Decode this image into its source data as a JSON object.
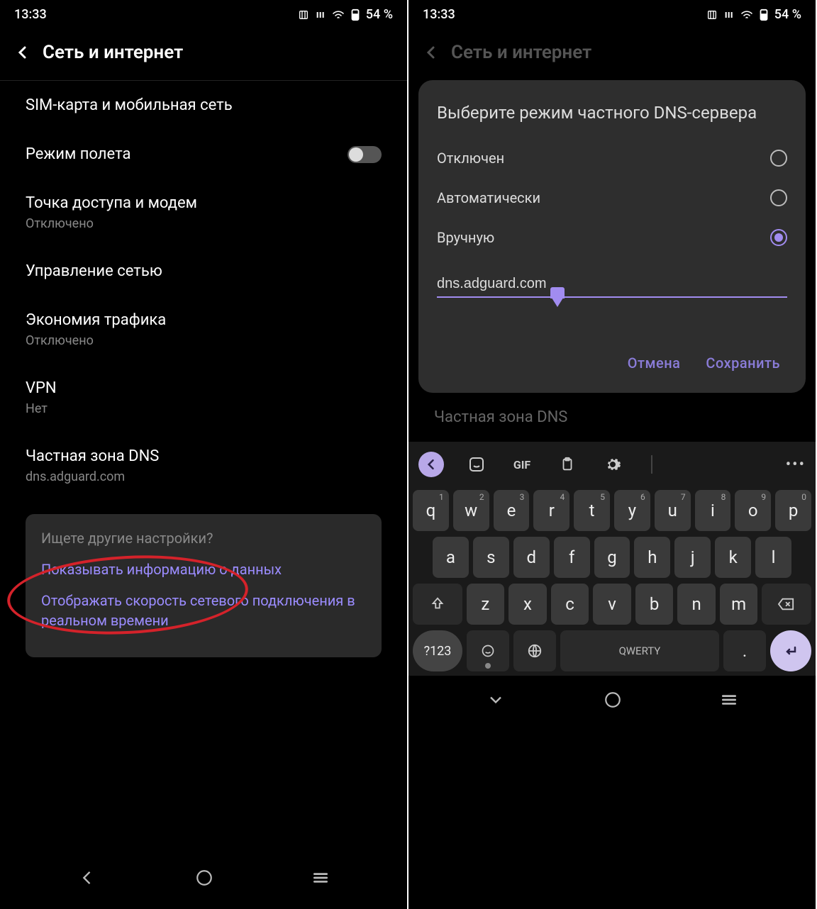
{
  "status": {
    "time": "13:33",
    "battery": "54 %"
  },
  "left": {
    "title": "Сеть и интернет",
    "items": {
      "sim": "SIM-карта и мобильная сеть",
      "airplane": "Режим полета",
      "hotspot": "Точка доступа и модем",
      "hotspot_sub": "Отключено",
      "network_manage": "Управление сетью",
      "data_saver": "Экономия трафика",
      "data_saver_sub": "Отключено",
      "vpn": "VPN",
      "vpn_sub": "Нет",
      "private_dns": "Частная зона DNS",
      "private_dns_sub": "dns.adguard.com"
    },
    "hints": {
      "title": "Ищете другие настройки?",
      "link1": "Показывать информацию о данных",
      "link2": "Отображать скорость сетевого подключения в реальном времени"
    }
  },
  "right": {
    "title": "Сеть и интернет",
    "behind": "Частная зона DNS",
    "dialog": {
      "title": "Выберите режим частного DNS-сервера",
      "opt_off": "Отключен",
      "opt_auto": "Автоматически",
      "opt_manual": "Вручную",
      "input_value": "dns.adguard.com",
      "cancel": "Отмена",
      "save": "Сохранить"
    }
  },
  "keyboard": {
    "gif": "GIF",
    "row1": [
      "q",
      "w",
      "e",
      "r",
      "t",
      "y",
      "u",
      "i",
      "o",
      "p"
    ],
    "row1_sup": [
      "1",
      "2",
      "3",
      "4",
      "5",
      "6",
      "7",
      "8",
      "9",
      "0"
    ],
    "row2": [
      "a",
      "s",
      "d",
      "f",
      "g",
      "h",
      "j",
      "k",
      "l"
    ],
    "row3": [
      "z",
      "x",
      "c",
      "v",
      "b",
      "n",
      "m"
    ],
    "num": "?123",
    "space": "QWERTY",
    "period": "."
  }
}
